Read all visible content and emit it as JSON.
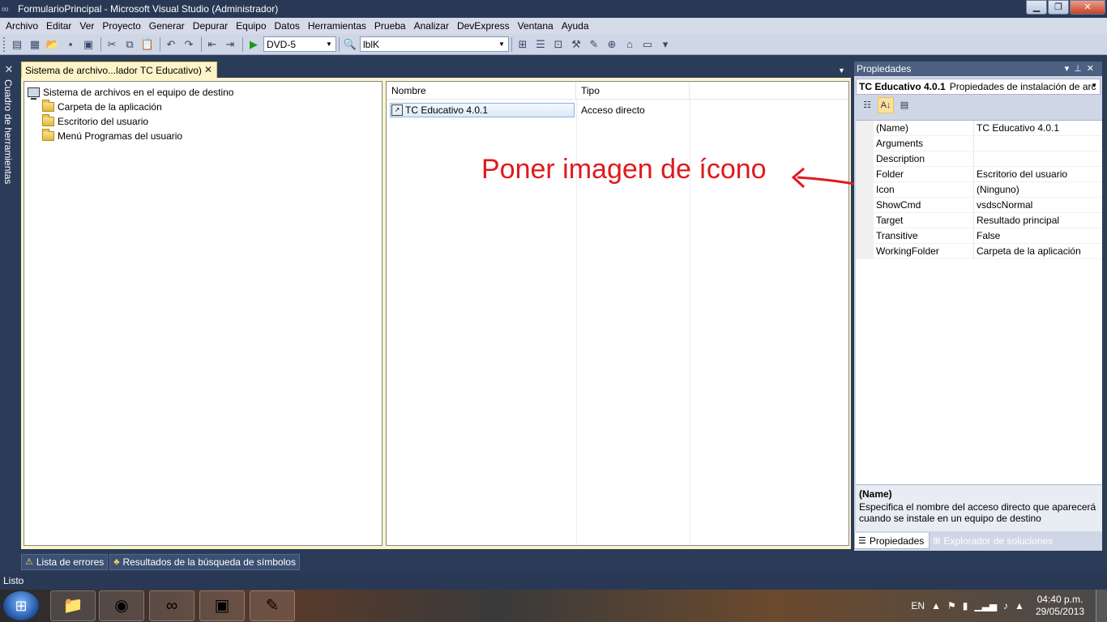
{
  "window": {
    "title": "FormularioPrincipal - Microsoft Visual Studio (Administrador)",
    "minimize": "▁",
    "maximize": "❐",
    "close": "✕"
  },
  "menu": [
    "Archivo",
    "Editar",
    "Ver",
    "Proyecto",
    "Generar",
    "Depurar",
    "Equipo",
    "Datos",
    "Herramientas",
    "Prueba",
    "Analizar",
    "DevExpress",
    "Ventana",
    "Ayuda"
  ],
  "toolbar": {
    "config_value": "DVD-5",
    "find_value": "lblK"
  },
  "toolbox": {
    "label": "Cuadro de herramientas"
  },
  "document_tab": {
    "label": "Sistema de archivo...lador TC Educativo)",
    "close": "✕"
  },
  "tree": {
    "root": "Sistema de archivos en el equipo de destino",
    "items": [
      "Carpeta de la aplicación",
      "Escritorio del usuario",
      "Menú Programas del usuario"
    ]
  },
  "list": {
    "columns": [
      "Nombre",
      "Tipo"
    ],
    "rows": [
      {
        "name": "TC Educativo 4.0.1",
        "type": "Acceso directo"
      }
    ]
  },
  "annotation": {
    "text": "Poner imagen de ícono",
    "color": "#e0191e"
  },
  "properties": {
    "title": "Propiedades",
    "object_name": "TC Educativo 4.0.1",
    "object_desc": "Propiedades de instalación de arc",
    "rows": [
      {
        "name": "(Name)",
        "value": "TC Educativo 4.0.1"
      },
      {
        "name": "Arguments",
        "value": ""
      },
      {
        "name": "Description",
        "value": ""
      },
      {
        "name": "Folder",
        "value": "Escritorio del usuario"
      },
      {
        "name": "Icon",
        "value": "(Ninguno)"
      },
      {
        "name": "ShowCmd",
        "value": "vsdscNormal"
      },
      {
        "name": "Target",
        "value": "Resultado principal"
      },
      {
        "name": "Transitive",
        "value": "False"
      },
      {
        "name": "WorkingFolder",
        "value": "Carpeta de la aplicación"
      }
    ],
    "desc_title": "(Name)",
    "desc_text": "Especifica el nombre del acceso directo que aparecerá cuando se instale en un equipo de destino",
    "tab_properties": "Propiedades",
    "tab_solution": "Explorador de soluciones"
  },
  "bottom_tabs": [
    "Lista de errores",
    "Resultados de la búsqueda de símbolos"
  ],
  "status": "Listo",
  "taskbar": {
    "lang": "EN",
    "time": "04:40 p.m.",
    "date": "29/05/2013"
  }
}
